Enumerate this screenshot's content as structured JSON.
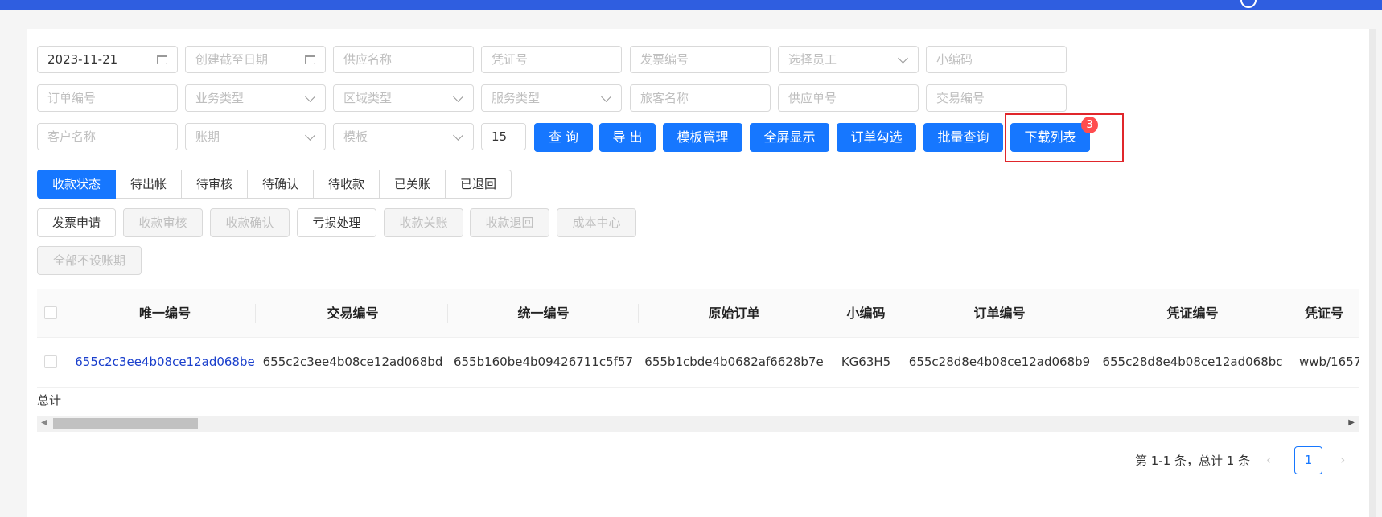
{
  "filters": {
    "row1": [
      {
        "value": "2023-11-21",
        "placeholder": "",
        "icon": "calendar-icon"
      },
      {
        "value": "",
        "placeholder": "创建截至日期",
        "icon": "calendar-icon"
      },
      {
        "value": "",
        "placeholder": "供应名称"
      },
      {
        "value": "",
        "placeholder": "凭证号"
      },
      {
        "value": "",
        "placeholder": "发票编号"
      },
      {
        "value": "",
        "placeholder": "选择员工",
        "icon": "chevron-down-icon"
      },
      {
        "value": "",
        "placeholder": "小编码"
      }
    ],
    "row2": [
      {
        "value": "",
        "placeholder": "订单编号"
      },
      {
        "value": "",
        "placeholder": "业务类型",
        "icon": "chevron-down-icon"
      },
      {
        "value": "",
        "placeholder": "区域类型",
        "icon": "chevron-down-icon"
      },
      {
        "value": "",
        "placeholder": "服务类型",
        "icon": "chevron-down-icon"
      },
      {
        "value": "",
        "placeholder": "旅客名称"
      },
      {
        "value": "",
        "placeholder": "供应单号"
      },
      {
        "value": "",
        "placeholder": "交易编号"
      }
    ],
    "row3": [
      {
        "value": "",
        "placeholder": "客户名称"
      },
      {
        "value": "",
        "placeholder": "账期",
        "icon": "chevron-down-icon"
      },
      {
        "value": "",
        "placeholder": "模板",
        "icon": "chevron-down-icon"
      },
      {
        "value": "15",
        "placeholder": ""
      }
    ]
  },
  "toolbar": {
    "query": "查 询",
    "export": "导 出",
    "template_manage": "模板管理",
    "fullscreen": "全屏显示",
    "order_select": "订单勾选",
    "batch_query": "批量查询",
    "download_list": "下载列表",
    "download_badge": "3"
  },
  "status_tabs": [
    "收款状态",
    "待出帐",
    "待审核",
    "待确认",
    "待收款",
    "已关账",
    "已退回"
  ],
  "action_buttons": [
    "发票申请",
    "收款审核",
    "收款确认",
    "亏损处理",
    "收款关账",
    "收款退回",
    "成本中心",
    "全部不设账期"
  ],
  "table": {
    "columns": [
      "唯一编号",
      "交易编号",
      "统一编号",
      "原始订单",
      "小编码",
      "订单编号",
      "凭证编号",
      "凭证号"
    ],
    "rows": [
      [
        "655c2c3ee4b08ce12ad068be",
        "655c2c3ee4b08ce12ad068bd",
        "655b160be4b09426711c5f57",
        "655b1cbde4b0682af6628b7e",
        "KG63H5",
        "655c28d8e4b08ce12ad068b9",
        "655c28d8e4b08ce12ad068bc",
        "wwb/1657"
      ]
    ],
    "total_label": "总计"
  },
  "pagination": {
    "summary": "第 1-1 条，总计 1 条",
    "current_page": "1",
    "prev_icon": "chevron-left-icon",
    "next_icon": "chevron-right-icon"
  },
  "colors": {
    "primary": "#1677ff",
    "top_bar": "#2f5ee0",
    "highlight": "#e0262b",
    "badge": "#ff4d4f",
    "link": "#1a3fcc"
  }
}
